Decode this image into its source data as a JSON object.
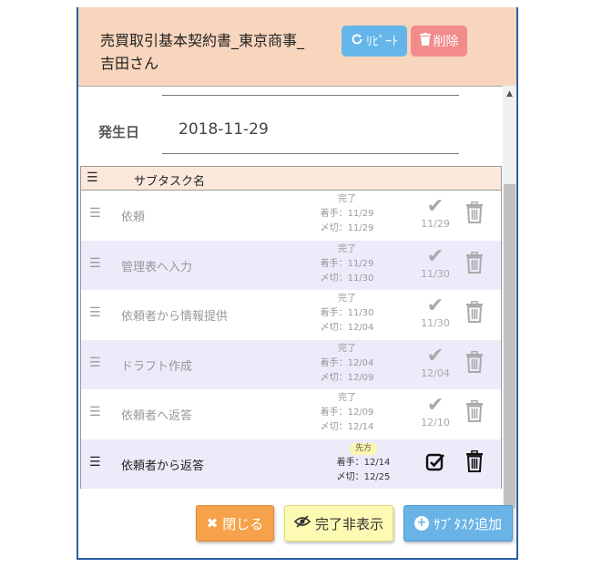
{
  "header": {
    "title": "売買取引基本契約書_東京商事_吉田さん",
    "repeat_label": "ﾘﾋﾟｰﾄ",
    "delete_label": "削除"
  },
  "date": {
    "label": "発生日",
    "value": "2018-11-29"
  },
  "subtasks": {
    "column_header": "サブタスク名",
    "rows": [
      {
        "name": "依頼",
        "status": "完了",
        "start": "着手：11/29",
        "due": "〆切：11/29",
        "done_date": "11/29"
      },
      {
        "name": "管理表へ入力",
        "status": "完了",
        "start": "着手：11/29",
        "due": "〆切：11/30",
        "done_date": "11/30"
      },
      {
        "name": "依頼者から情報提供",
        "status": "完了",
        "start": "着手：11/30",
        "due": "〆切：12/04",
        "done_date": "11/30"
      },
      {
        "name": "ドラフト作成",
        "status": "完了",
        "start": "着手：12/04",
        "due": "〆切：12/09",
        "done_date": "12/04"
      },
      {
        "name": "依頼者へ返答",
        "status": "完了",
        "start": "着手：12/09",
        "due": "〆切：12/14",
        "done_date": "12/10"
      },
      {
        "name": "依頼者から返答",
        "status": "先方",
        "start": "着手：12/14",
        "due": "〆切：12/25",
        "done_date": ""
      }
    ]
  },
  "footer": {
    "close_label": "閉じる",
    "hide_done_label": "完了非表示",
    "add_subtask_label": "ｻﾌﾞﾀｽｸ追加"
  },
  "colors": {
    "header_bg": "#f8d5bd",
    "row_alt_bg": "#ecebfa",
    "repeat_btn": "#64b5ea",
    "delete_btn": "#f28b8b",
    "close_btn": "#f5a24a",
    "hide_btn": "#fdfbb3",
    "add_btn": "#6ab3e6",
    "border": "#2c5fa3"
  }
}
